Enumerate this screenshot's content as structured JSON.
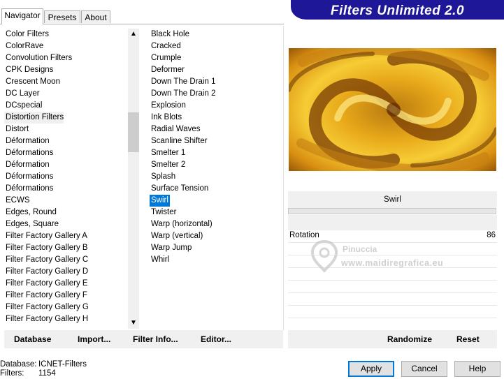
{
  "tabs": [
    "Navigator",
    "Presets",
    "About"
  ],
  "banner_title": "Filters Unlimited 2.0",
  "categories": [
    "Color Filters",
    "ColorRave",
    "Convolution Filters",
    "CPK Designs",
    "Crescent Moon",
    "DC Layer",
    "DCspecial",
    "Distortion Filters",
    "Distort",
    "Déformation",
    "Déformations",
    "Déformation",
    "Déformations",
    "Déformations",
    "ECWS",
    "Edges, Round",
    "Edges, Square",
    "Filter Factory Gallery A",
    "Filter Factory Gallery B",
    "Filter Factory Gallery C",
    "Filter Factory Gallery D",
    "Filter Factory Gallery E",
    "Filter Factory Gallery F",
    "Filter Factory Gallery G",
    "Filter Factory Gallery H"
  ],
  "selected_category": "Distortion Filters",
  "filters": [
    "Black Hole",
    "Cracked",
    "Crumple",
    "Deformer",
    "Down The Drain 1",
    "Down The Drain 2",
    "Explosion",
    "Ink Blots",
    "Radial Waves",
    "Scanline Shifter",
    "Smelter 1",
    "Smelter 2",
    "Splash",
    "Surface Tension",
    "Swirl",
    "Twister",
    "Warp (horizontal)",
    "Warp (vertical)",
    "Warp Jump",
    "Whirl"
  ],
  "selected_filter": "Swirl",
  "filter_name": "Swirl",
  "params": [
    {
      "label": "Rotation",
      "value": "86"
    }
  ],
  "watermark": {
    "line1": "Pinuccia",
    "line2": "www.maidiregrafica.eu"
  },
  "buttons": {
    "database": "Database",
    "import": "Import...",
    "filter_info": "Filter Info...",
    "editor": "Editor...",
    "randomize": "Randomize",
    "reset": "Reset",
    "apply": "Apply",
    "cancel": "Cancel",
    "help": "Help"
  },
  "status": {
    "database_label": "Database:",
    "database_value": "ICNET-Filters",
    "filters_label": "Filters:",
    "filters_value": "1154"
  },
  "colors": {
    "banner": "#1e1898",
    "selection": "#0078d7"
  }
}
